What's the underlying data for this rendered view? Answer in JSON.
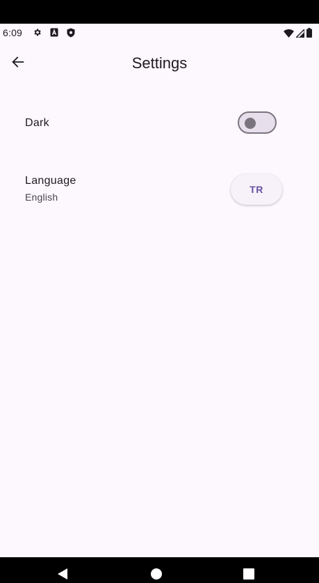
{
  "status_bar": {
    "time": "6:09",
    "left_icons": [
      "gear-icon",
      "a-box-icon",
      "shield-icon"
    ],
    "right_icons": [
      "wifi-icon",
      "signal-icon",
      "battery-icon"
    ]
  },
  "app_bar": {
    "title": "Settings",
    "back_icon": "arrow-left-icon"
  },
  "settings": {
    "dark": {
      "label": "Dark",
      "enabled": false
    },
    "language": {
      "label": "Language",
      "value": "English",
      "button_label": "TR"
    }
  },
  "nav_bar": {
    "buttons": [
      "back",
      "home",
      "recents"
    ]
  },
  "colors": {
    "background": "#fdf7fe",
    "accent": "#6750a4",
    "outline": "#79747e"
  }
}
